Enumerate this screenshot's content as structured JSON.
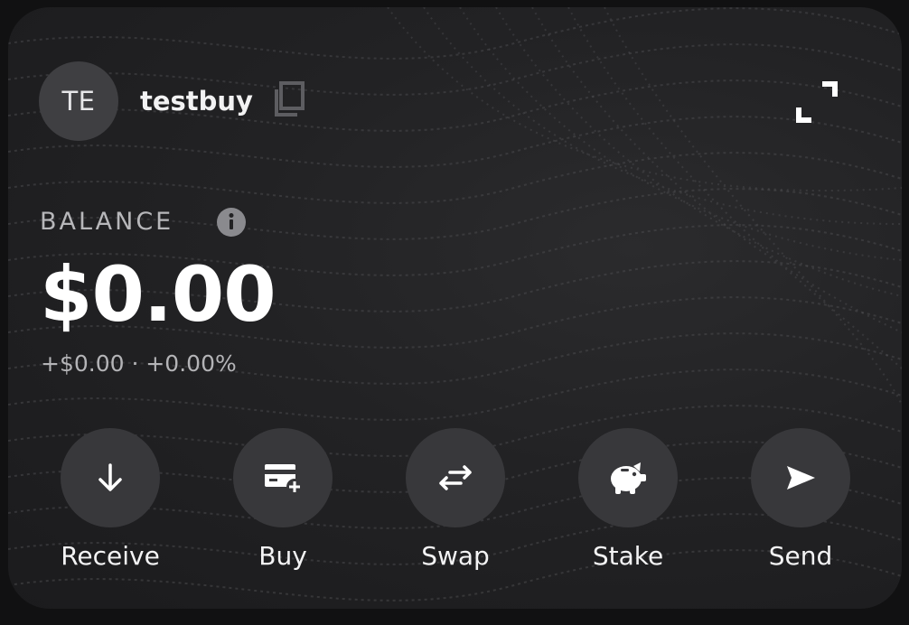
{
  "account": {
    "avatar_initials": "TE",
    "name": "testbuy"
  },
  "balance": {
    "label": "BALANCE",
    "amount": "$0.00",
    "change": "+$0.00 · +0.00%"
  },
  "actions": [
    {
      "label": "Receive",
      "icon": "arrow-down-icon"
    },
    {
      "label": "Buy",
      "icon": "card-plus-icon"
    },
    {
      "label": "Swap",
      "icon": "swap-arrows-icon"
    },
    {
      "label": "Stake",
      "icon": "piggy-bank-icon"
    },
    {
      "label": "Send",
      "icon": "send-icon"
    }
  ],
  "colors": {
    "background": "#111112",
    "card": "#222224",
    "button": "#38383b",
    "text": "#ffffff",
    "muted_text": "#b7b7ba"
  }
}
